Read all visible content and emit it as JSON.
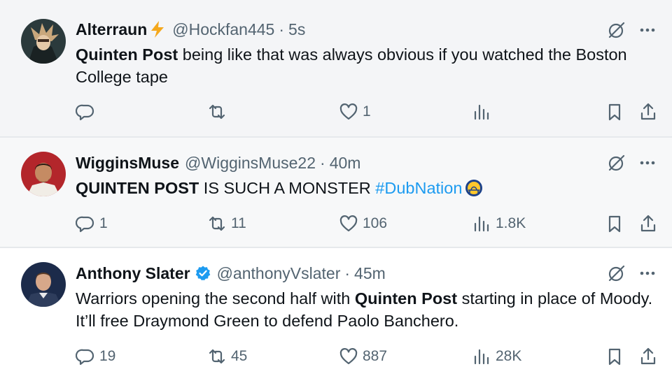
{
  "tweets": [
    {
      "name": "Alterraun",
      "name_emoji": "lightning-bolt",
      "handle": "@Hockfan445",
      "separator": "·",
      "time": "5s",
      "body": [
        {
          "text": "Quinten Post",
          "bold": true
        },
        {
          "text": " being like that was always obvious if you watched the Boston College tape",
          "bold": false
        }
      ],
      "stats": {
        "replies": "",
        "retweets": "",
        "likes": "1",
        "views": ""
      }
    },
    {
      "name": "WigginsMuse",
      "handle": "@WigginsMuse22",
      "separator": "·",
      "time": "40m",
      "body": [
        {
          "text": "QUINTEN POST",
          "bold": true
        },
        {
          "text": " IS SUCH A MONSTER ",
          "bold": false
        },
        {
          "text": "#DubNation",
          "hashtag": true
        }
      ],
      "body_trailing_icon": "warriors-logo",
      "stats": {
        "replies": "1",
        "retweets": "11",
        "likes": "106",
        "views": "1.8K"
      }
    },
    {
      "name": "Anthony Slater",
      "verified": true,
      "handle": "@anthonyVslater",
      "separator": "·",
      "time": "45m",
      "body": [
        {
          "text": "Warriors opening the second half with ",
          "bold": false
        },
        {
          "text": "Quinten Post",
          "bold": true
        },
        {
          "text": " starting in place of Moody. It’ll free Draymond Green to defend Paolo Banchero.",
          "bold": false
        }
      ],
      "stats": {
        "replies": "19",
        "retweets": "45",
        "likes": "887",
        "views": "28K"
      }
    }
  ],
  "icons": {
    "reply": "reply-icon",
    "retweet": "retweet-icon",
    "like": "heart-icon",
    "views": "views-icon",
    "bookmark": "bookmark-icon",
    "share": "share-icon",
    "grok": "grok-icon",
    "more": "more-icon"
  },
  "colors": {
    "text": "#0f1419",
    "muted": "#536471",
    "hashtag": "#1d9bf0",
    "verified": "#1d9bf0"
  }
}
